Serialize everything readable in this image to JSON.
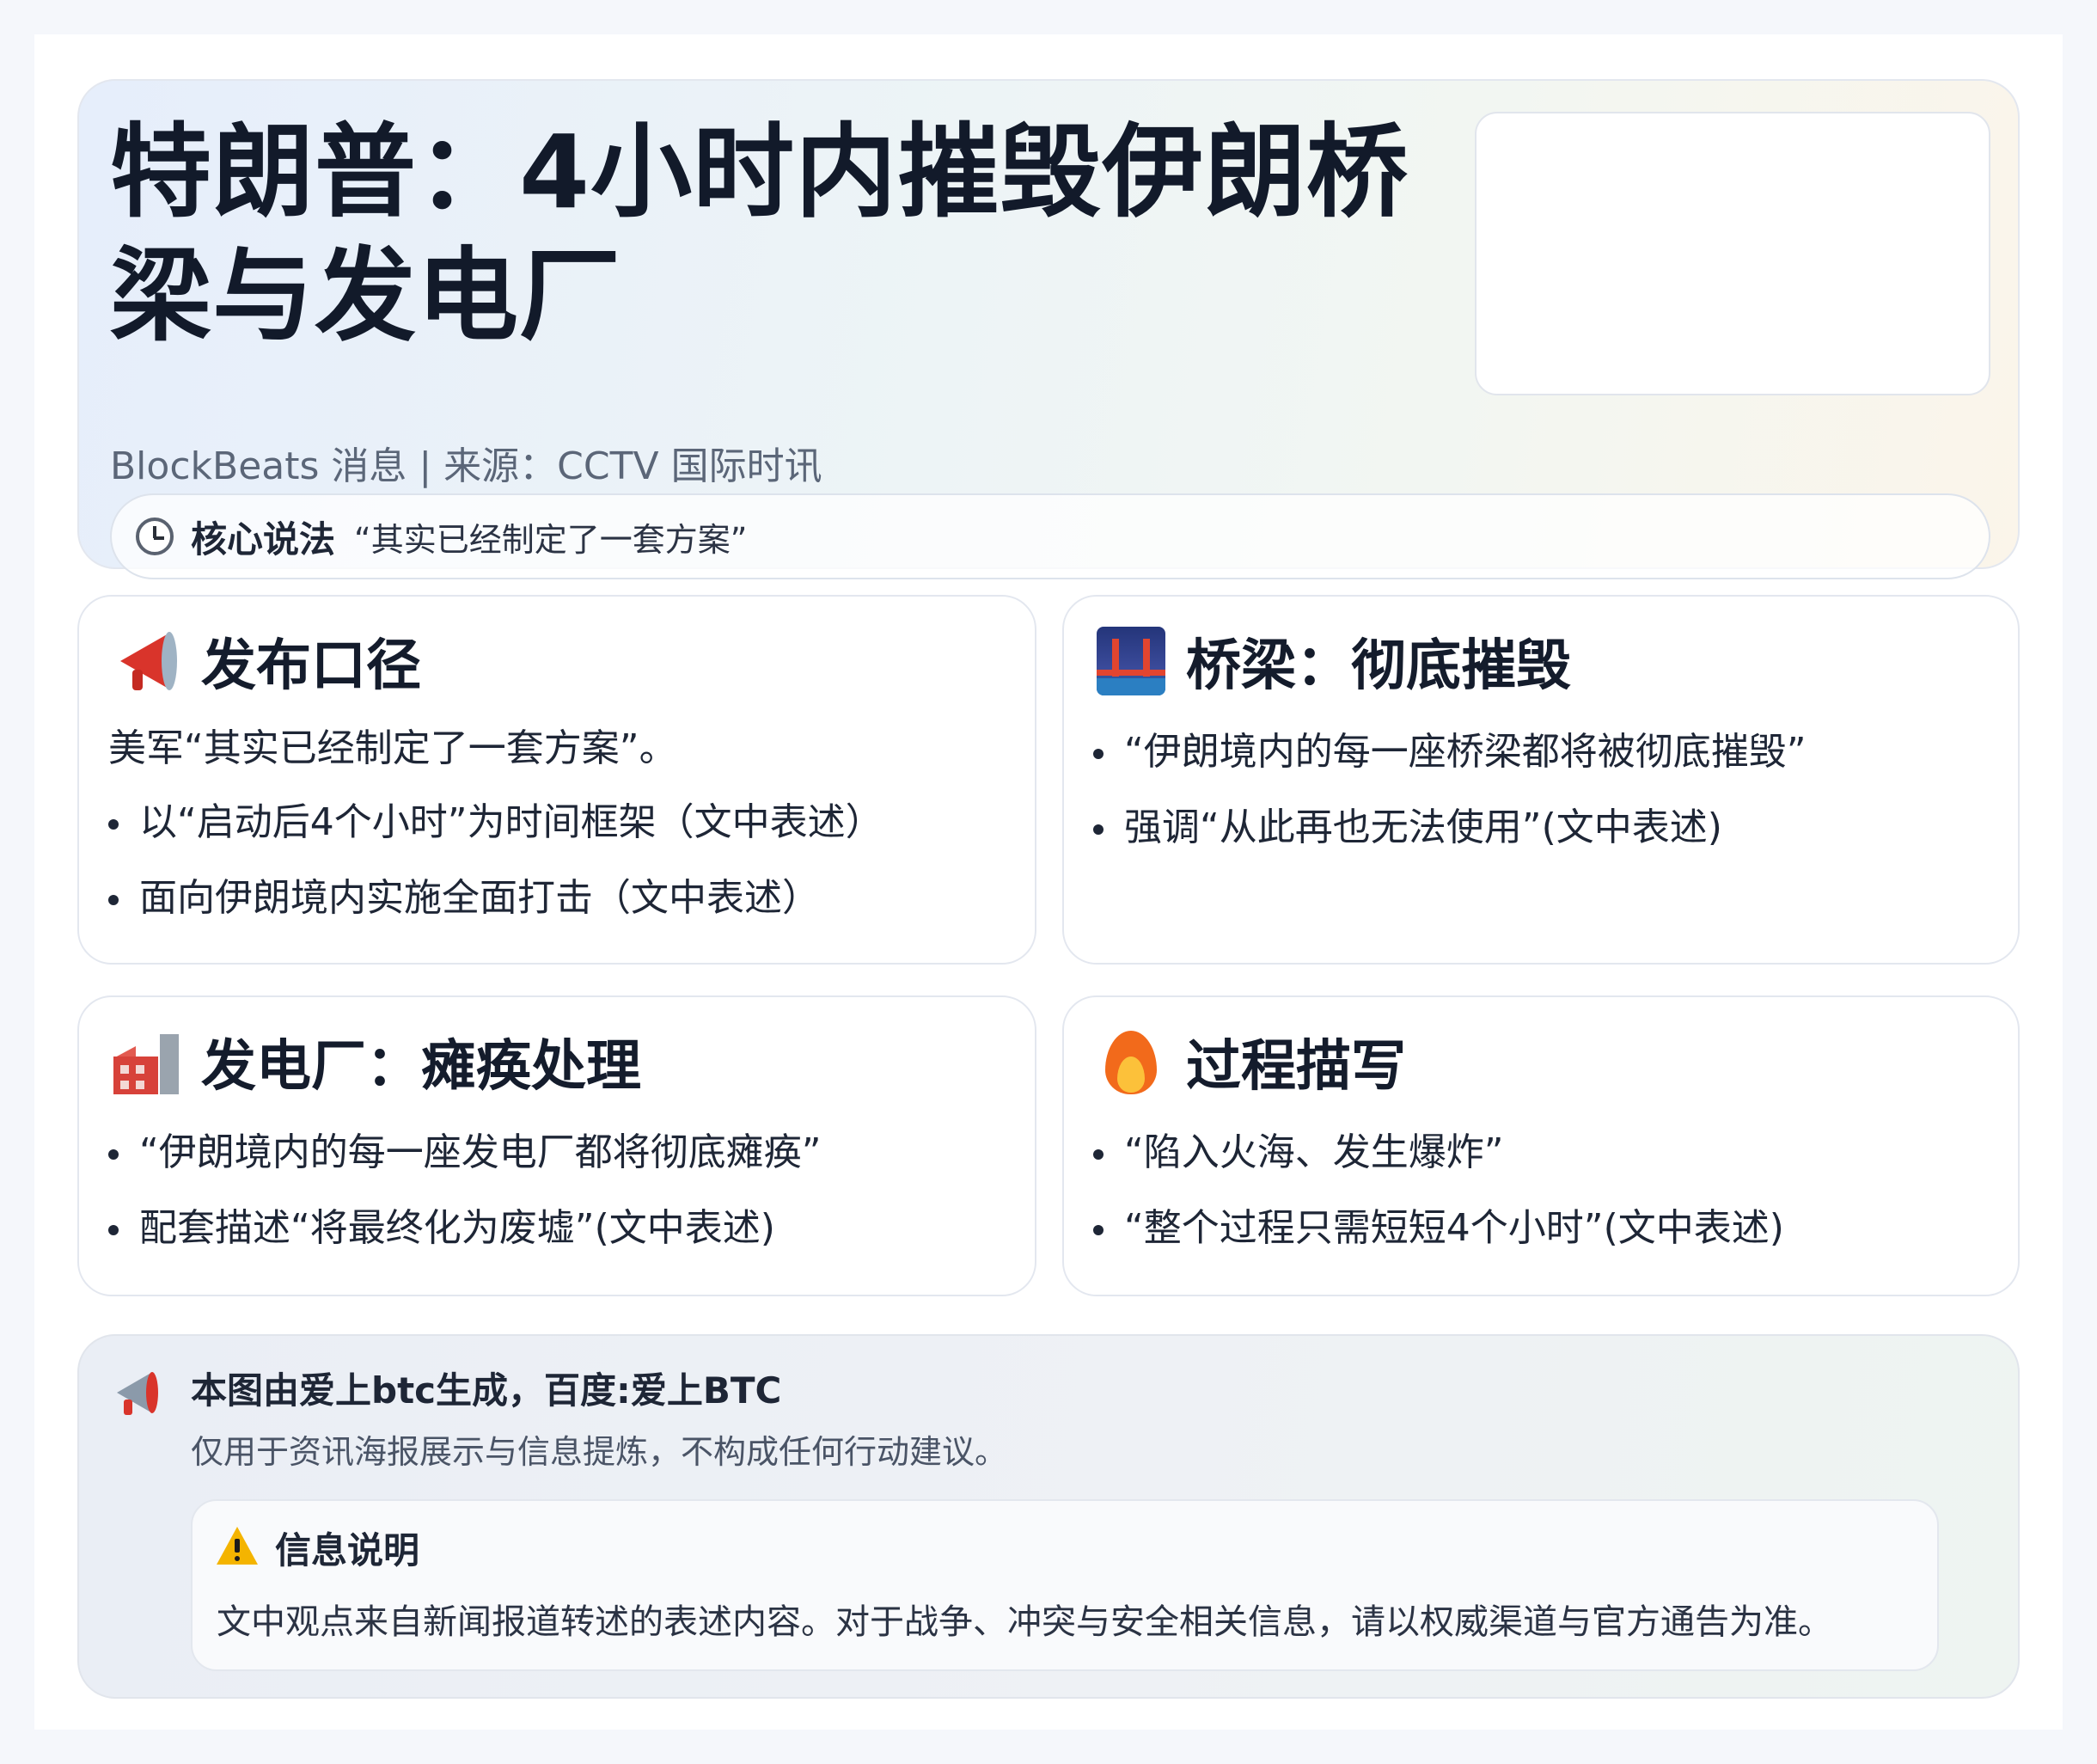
{
  "hero": {
    "title": "特朗普：4小时内摧毁伊朗桥梁与发电厂",
    "source": "BlockBeats 消息 | 来源：CCTV 国际时讯",
    "core_label": "核心说法",
    "core_quote": "“其实已经制定了一套方案”",
    "core_icon": "clock-icon"
  },
  "cards": [
    {
      "icon": "megaphone-icon",
      "title": "发布口径",
      "intro": "美军“其实已经制定了一套方案”。",
      "items": [
        "以“启动后4个小时”为时间框架（文中表述）",
        "面向伊朗境内实施全面打击（文中表述）"
      ]
    },
    {
      "icon": "bridge-icon",
      "title": "桥梁：彻底摧毁",
      "items": [
        "“伊朗境内的每一座桥梁都将被彻底摧毁”",
        "强调“从此再也无法使用”(文中表述)"
      ]
    },
    {
      "icon": "factory-icon",
      "title": "发电厂：瘫痪处理",
      "items": [
        "“伊朗境内的每一座发电厂都将彻底瘫痪”",
        "配套描述“将最终化为废墟”(文中表述)"
      ]
    },
    {
      "icon": "fire-icon",
      "title": "过程描写",
      "items": [
        "“陷入火海、发生爆炸”",
        "“整个过程只需短短4个小时”(文中表述)"
      ]
    }
  ],
  "footer": {
    "icon": "megaphone-icon",
    "title": "本图由爱上btc生成，百度:爱上BTC",
    "subtitle": "仅用于资讯海报展示与信息提炼，不构成任何行动建议。",
    "notice_icon": "warning-icon",
    "notice_title": "信息说明",
    "notice_text": "文中观点来自新闻报道转述的表述内容。对于战争、冲突与安全相关信息，请以权威渠道与官方通告为准。"
  },
  "colors": {
    "accent_red": "#d9342b",
    "title_text": "#121a2a",
    "muted_text": "#5b6678"
  }
}
